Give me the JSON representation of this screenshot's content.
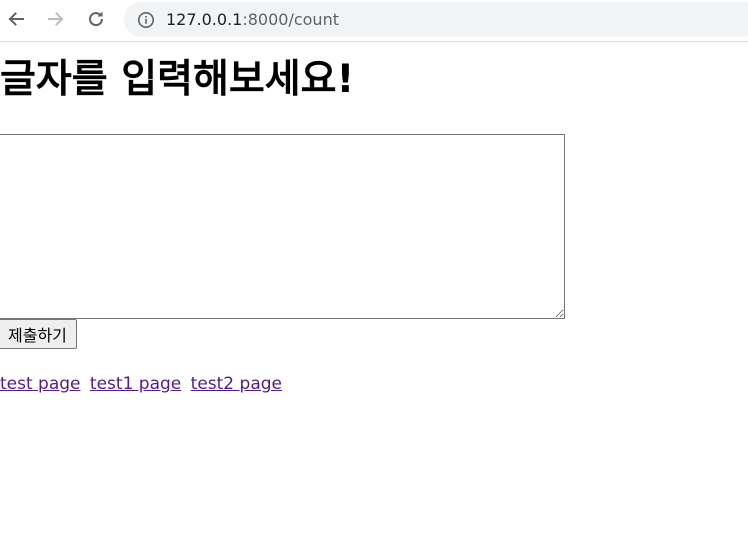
{
  "browser": {
    "url_host": "127.0.0.1",
    "url_rest": ":8000/count",
    "back_icon": "back-arrow-icon",
    "forward_icon": "forward-arrow-icon",
    "reload_icon": "reload-icon",
    "info_icon": "info-icon"
  },
  "page": {
    "heading": "글자를 입력해보세요!",
    "textarea_value": "",
    "submit_label": "제출하기",
    "links": [
      {
        "label": "test page"
      },
      {
        "label": "test1 page"
      },
      {
        "label": "test2 page"
      }
    ],
    "link_color": "#551a8b"
  }
}
